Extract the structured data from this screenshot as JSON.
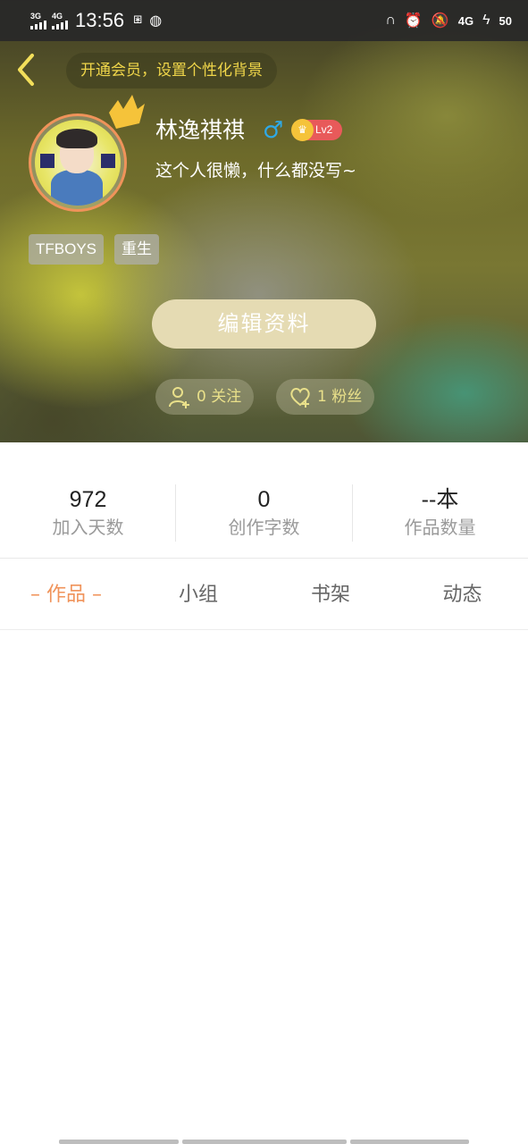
{
  "status_bar": {
    "net1": "3G",
    "net2": "4G",
    "time": "13:56",
    "net3": "4G",
    "battery": "50"
  },
  "header": {
    "vip_banner": "开通会员，设置个性化背景",
    "username": "林逸祺祺",
    "gender_symbol": "♂",
    "level": "Lv2",
    "bio": "这个人很懒，什么都没写~",
    "tags": [
      "TFBOYS",
      "重生"
    ],
    "edit_button": "编辑资料",
    "following": "0 关注",
    "fans": "1 粉丝"
  },
  "stats": [
    {
      "value": "972",
      "label": "加入天数"
    },
    {
      "value": "0",
      "label": "创作字数"
    },
    {
      "value": "--本",
      "label": "作品数量"
    }
  ],
  "tabs": [
    "– 作品 –",
    "小组",
    "书架",
    "动态"
  ],
  "colors": {
    "accent": "#f0935a",
    "vip_text": "#f0d64a",
    "level_badge": "#e85a5a",
    "gender": "#2fa9e6"
  }
}
